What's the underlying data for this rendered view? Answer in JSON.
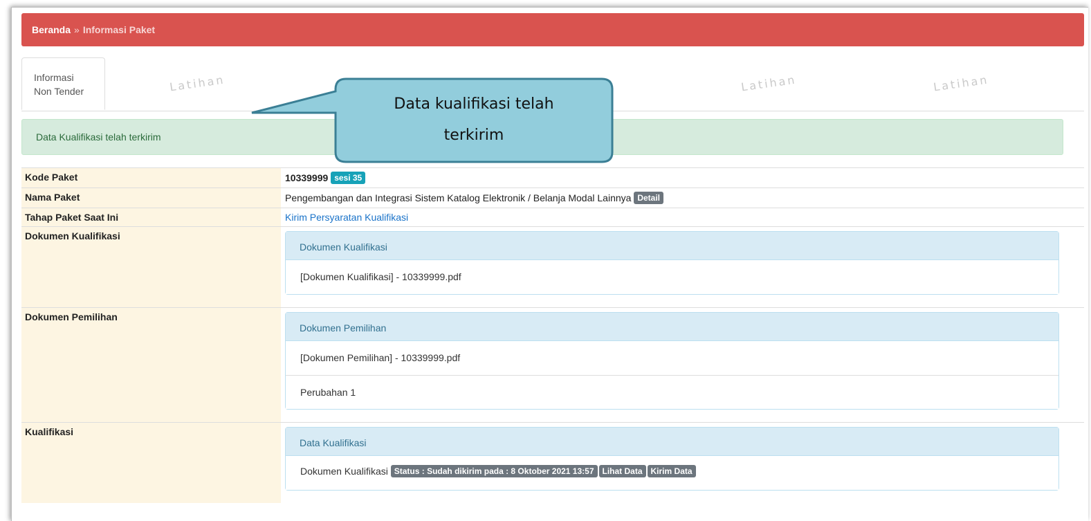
{
  "breadcrumb": {
    "home": "Beranda",
    "separator": "»",
    "current": "Informasi Paket"
  },
  "tab": {
    "line1": "Informasi",
    "line2": "Non Tender"
  },
  "watermark": "Latihan",
  "alert": "Data Kualifikasi telah terkirim",
  "callout": {
    "line1": "Data kualifikasi telah",
    "line2": "terkirim"
  },
  "rows": {
    "kode": {
      "label": "Kode Paket",
      "value": "10339999",
      "badge": "sesi 35"
    },
    "nama": {
      "label": "Nama Paket",
      "value": "Pengembangan dan Integrasi Sistem Katalog Elektronik / Belanja Modal Lainnya",
      "badge": "Detail"
    },
    "tahap": {
      "label": "Tahap Paket Saat Ini",
      "value": "Kirim Persyaratan Kualifikasi"
    },
    "dokumen_kualifikasi": {
      "label": "Dokumen Kualifikasi",
      "panel_title": "Dokumen Kualifikasi",
      "items": [
        "[Dokumen Kualifikasi] - 10339999.pdf"
      ]
    },
    "dokumen_pemilihan": {
      "label": "Dokumen Pemilihan",
      "panel_title": "Dokumen Pemilihan",
      "items": [
        "[Dokumen Pemilihan] - 10339999.pdf",
        "Perubahan 1"
      ]
    },
    "kualifikasi": {
      "label": "Kualifikasi",
      "panel_title": "Data Kualifikasi",
      "item_text": "Dokumen Kualifikasi",
      "status_badge": "Status : Sudah dikirim pada : 8 Oktober 2021 13:57",
      "lihat_label": "Lihat Data",
      "kirim_label": "Kirim Data"
    }
  },
  "colors": {
    "header": "#d9534f",
    "alert_bg": "#d6ebdd",
    "label_bg": "#fdf5e2",
    "panel_head": "#d8ebf5",
    "callout": "#92cddc",
    "callout_border": "#3b7f95"
  }
}
